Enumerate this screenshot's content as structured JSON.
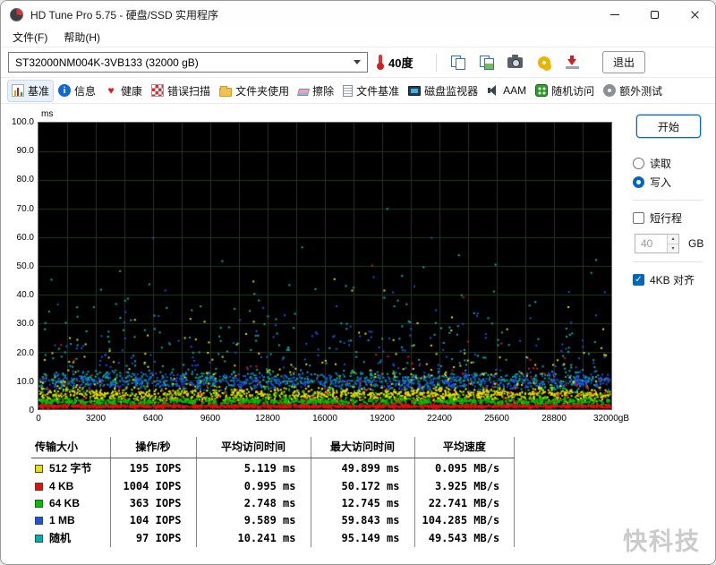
{
  "window": {
    "title": "HD Tune Pro 5.75 - 硬盘/SSD 实用程序"
  },
  "menu": {
    "items": [
      {
        "id": "file",
        "label": "文件(F)"
      },
      {
        "id": "help",
        "label": "帮助(H)"
      }
    ]
  },
  "toolbar": {
    "drive_selector": "ST32000NM004K-3VB133 (32000 gB)",
    "temperature": "40度",
    "icon_buttons": [
      "copy-pages-icon",
      "copy-image-icon",
      "camera-icon",
      "gears-icon",
      "save-results-icon"
    ],
    "exit_label": "退出"
  },
  "tabs": [
    {
      "id": "benchmark",
      "label": "基准",
      "icon": "ti-benchmark",
      "active": true
    },
    {
      "id": "info",
      "label": "信息",
      "icon": "ti-info",
      "active": false
    },
    {
      "id": "health",
      "label": "健康",
      "icon": "ti-health",
      "active": false
    },
    {
      "id": "error-scan",
      "label": "错误扫描",
      "icon": "ti-scan",
      "active": false
    },
    {
      "id": "folder-usage",
      "label": "文件夹使用",
      "icon": "ti-folder",
      "active": false
    },
    {
      "id": "erase",
      "label": "擦除",
      "icon": "ti-erase",
      "active": false
    },
    {
      "id": "file-benchmark",
      "label": "文件基准",
      "icon": "ti-filebench",
      "active": false
    },
    {
      "id": "disk-monitor",
      "label": "磁盘监视器",
      "icon": "ti-monitor",
      "active": false
    },
    {
      "id": "aam",
      "label": "AAM",
      "icon": "ti-aam",
      "active": false
    },
    {
      "id": "random-access",
      "label": "随机访问",
      "icon": "ti-random",
      "active": false
    },
    {
      "id": "extra-tests",
      "label": "额外测试",
      "icon": "ti-extra",
      "active": false
    }
  ],
  "benchmark_panel": {
    "start_label": "开始",
    "read_label": "读取",
    "read_selected": false,
    "write_label": "写入",
    "write_selected": true,
    "short_stroke_label": "短行程",
    "short_stroke_checked": false,
    "short_stroke_value": "40",
    "gb_label": "GB",
    "align_label": "4KB 对齐",
    "align_checked": true
  },
  "chart_data": {
    "type": "scatter",
    "ylabel": "ms",
    "xlabel": "",
    "x_unit": "gB",
    "xlim": [
      0,
      32000
    ],
    "ylim": [
      0,
      100
    ],
    "x_tick_values": [
      0,
      3200,
      6400,
      9600,
      12800,
      16000,
      19200,
      22400,
      25600,
      28800,
      32000
    ],
    "x_tick_labels": [
      "0",
      "3200",
      "6400",
      "9600",
      "12800",
      "16000",
      "19200",
      "22400",
      "25600",
      "28800",
      "32000gB"
    ],
    "y_tick_values": [
      100,
      90,
      80,
      70,
      60,
      50,
      40,
      30,
      20,
      10,
      0
    ],
    "y_tick_labels": [
      "100.0",
      "90.0",
      "80.0",
      "70.0",
      "60.0",
      "50.0",
      "40.0",
      "30.0",
      "20.0",
      "10.0",
      "0"
    ],
    "background": "#000000",
    "grid_color": "#1e3a1e",
    "grid": true,
    "series": [
      {
        "name": "512 字节",
        "color": "#e8e000",
        "iops": 195,
        "avg_ms": 5.119,
        "max_ms": 49.899,
        "avg_speed_mbs": 0.095,
        "render": {
          "count": 1300,
          "base": 5.0,
          "spread": 2.2,
          "tail_rate": 0.16,
          "tail_scale": 8,
          "max": 49.9
        }
      },
      {
        "name": "4 KB",
        "color": "#e01010",
        "iops": 1004,
        "avg_ms": 0.995,
        "max_ms": 50.172,
        "avg_speed_mbs": 3.925,
        "render": {
          "count": 1600,
          "base": 1.0,
          "spread": 0.6,
          "tail_rate": 0.07,
          "tail_scale": 6,
          "max": 50.2
        }
      },
      {
        "name": "64 KB",
        "color": "#00c000",
        "iops": 363,
        "avg_ms": 2.748,
        "max_ms": 12.745,
        "avg_speed_mbs": 22.741,
        "render": {
          "count": 1100,
          "base": 2.6,
          "spread": 1.2,
          "tail_rate": 0.12,
          "tail_scale": 3,
          "max": 12.7
        }
      },
      {
        "name": "1 MB",
        "color": "#2050e0",
        "iops": 104,
        "avg_ms": 9.589,
        "max_ms": 59.843,
        "avg_speed_mbs": 104.285,
        "render": {
          "count": 850,
          "base": 9.3,
          "spread": 2.8,
          "tail_rate": 0.22,
          "tail_scale": 9,
          "max": 59.8
        }
      },
      {
        "name": "随机",
        "color": "#00b0b0",
        "iops": 97,
        "avg_ms": 10.241,
        "max_ms": 95.149,
        "avg_speed_mbs": 49.543,
        "render": {
          "count": 850,
          "base": 9.8,
          "spread": 3.5,
          "tail_rate": 0.3,
          "tail_scale": 13,
          "max": 95.1
        }
      }
    ],
    "draw_order": [
      4,
      3,
      0,
      2,
      1
    ]
  },
  "results_table": {
    "headers": [
      "传输大小",
      "操作/秒",
      "平均访问时间",
      "最大访问时间",
      "平均速度"
    ],
    "rows": [
      {
        "label": "512 字节",
        "color": "#e8e000",
        "ops": "195 IOPS",
        "avg": "5.119 ms",
        "max": "49.899 ms",
        "speed": "0.095 MB/s"
      },
      {
        "label": "4 KB",
        "color": "#e01010",
        "ops": "1004 IOPS",
        "avg": "0.995 ms",
        "max": "50.172 ms",
        "speed": "3.925 MB/s"
      },
      {
        "label": "64 KB",
        "color": "#00c000",
        "ops": "363 IOPS",
        "avg": "2.748 ms",
        "max": "12.745 ms",
        "speed": "22.741 MB/s"
      },
      {
        "label": "1 MB",
        "color": "#2050e0",
        "ops": "104 IOPS",
        "avg": "9.589 ms",
        "max": "59.843 ms",
        "speed": "104.285 MB/s"
      },
      {
        "label": "随机",
        "color": "#00b0b0",
        "ops": "97 IOPS",
        "avg": "10.241 ms",
        "max": "95.149 ms",
        "speed": "49.543 MB/s"
      }
    ]
  },
  "watermark": "快科技"
}
